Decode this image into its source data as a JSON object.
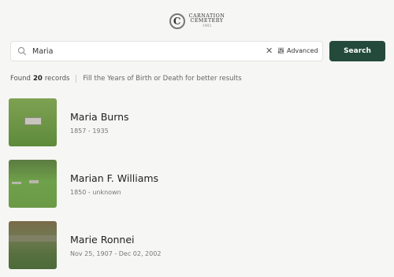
{
  "logo": {
    "letter": "C",
    "line1": "CARNATION",
    "line2": "CEMETERY",
    "year": "1902"
  },
  "search": {
    "value": "Maria",
    "clear_icon": "close-icon",
    "advanced_label": "Advanced",
    "button_label": "Search"
  },
  "results": {
    "found_prefix": "Found",
    "count": "20",
    "found_suffix": "records",
    "hint": "Fill the Years of Birth or Death for better results"
  },
  "records": [
    {
      "name": "Maria Burns",
      "dates": "1857 - 1935"
    },
    {
      "name": "Marian F. Williams",
      "dates": "1850 - unknown"
    },
    {
      "name": "Marie Ronnei",
      "dates": "Nov 25, 1907 - Dec 02, 2002"
    }
  ],
  "colors": {
    "accent": "#234a3a",
    "background": "#f6f6f4"
  }
}
